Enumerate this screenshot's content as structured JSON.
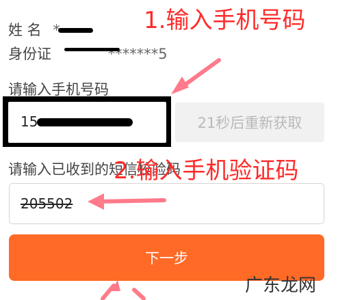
{
  "annotations": {
    "step1": "1.输入手机号码",
    "step2": "2.输入手机验证码"
  },
  "identity": {
    "name_label": "姓 名",
    "name_value": "*",
    "id_label": "身份证",
    "id_value": "*******5"
  },
  "phone": {
    "label": "请输入手机号码",
    "value": "15"
  },
  "get_code_button": "21秒后重新获取",
  "sms": {
    "label": "请输入已收到的短信校验码",
    "value": "205502"
  },
  "next_button": "下一步",
  "watermark": "广东龙网",
  "colors": {
    "accent": "#ff6a26",
    "annotation": "#ff2a2a",
    "disabled_text": "#b9b9b9"
  }
}
